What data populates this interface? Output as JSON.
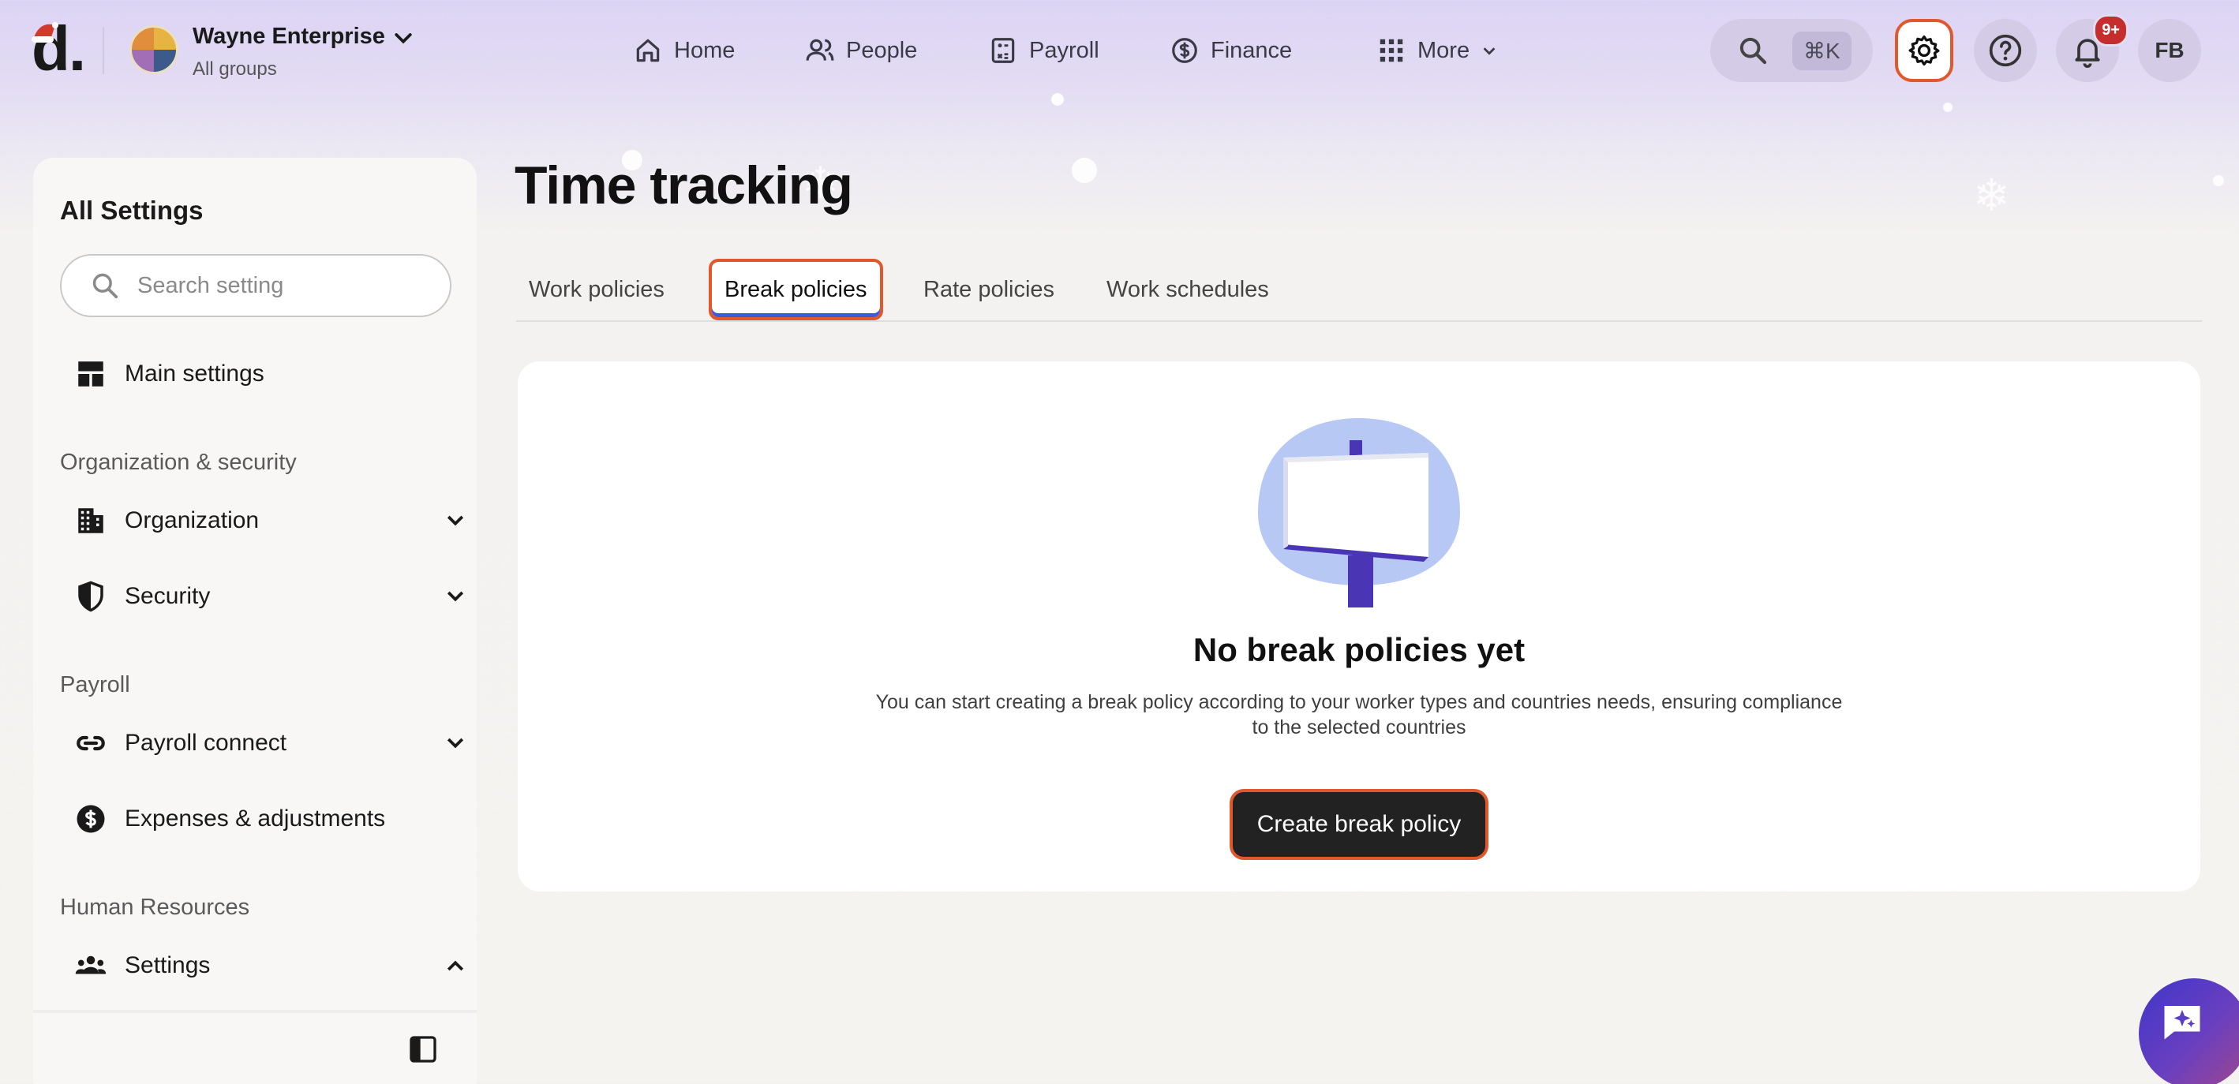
{
  "header": {
    "logo_text": "d.",
    "org": {
      "name": "Wayne Enterprise",
      "sub": "All groups"
    },
    "nav": [
      {
        "label": "Home",
        "icon": "home-icon"
      },
      {
        "label": "People",
        "icon": "people-icon"
      },
      {
        "label": "Payroll",
        "icon": "payroll-icon"
      },
      {
        "label": "Finance",
        "icon": "finance-icon"
      },
      {
        "label": "More",
        "icon": "grid-icon"
      }
    ],
    "search_shortcut": "⌘K",
    "notification_badge": "9+",
    "user_initials": "FB"
  },
  "sidebar": {
    "title": "All Settings",
    "search_placeholder": "Search setting",
    "main_settings": "Main settings",
    "sections": [
      {
        "label": "Organization & security",
        "items": [
          "Organization",
          "Security"
        ]
      },
      {
        "label": "Payroll",
        "items": [
          "Payroll connect",
          "Expenses & adjustments"
        ]
      },
      {
        "label": "Human Resources",
        "items": [
          "Settings"
        ]
      }
    ]
  },
  "main": {
    "title": "Time tracking",
    "tabs": [
      "Work policies",
      "Break policies",
      "Rate policies",
      "Work schedules"
    ],
    "active_tab": "Break policies",
    "empty_state": {
      "title": "No break policies yet",
      "description_line1": "You can start creating a break policy according to your worker types and countries needs, ensuring compliance",
      "description_line2": "to the selected countries",
      "button": "Create break policy"
    }
  },
  "colors": {
    "accent_outline": "#e0582c",
    "header_bg": "#dcd4f4",
    "button_dark": "#222222",
    "tab_indicator": "#3d5bd9"
  }
}
